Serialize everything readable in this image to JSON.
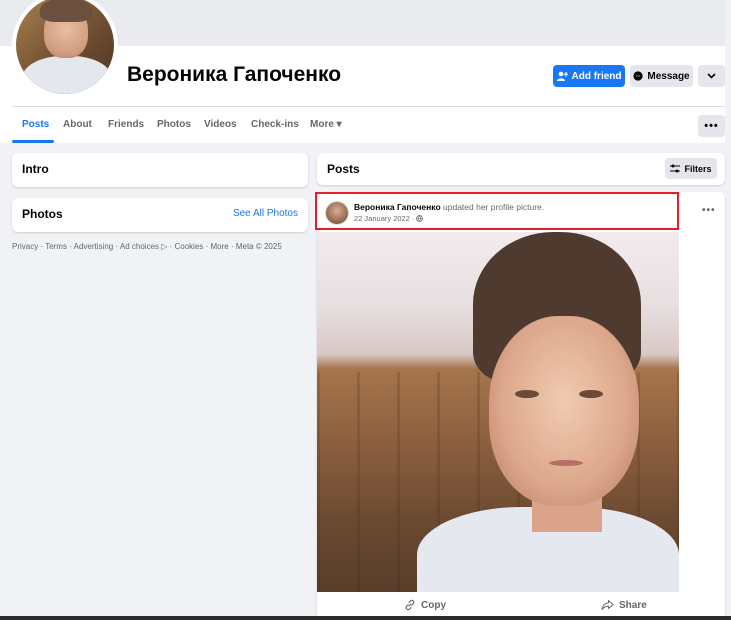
{
  "profile": {
    "name": "Вероника Гапоченко",
    "add_friend_label": "Add friend",
    "message_label": "Message"
  },
  "tabs": [
    {
      "label": "Posts",
      "active": true
    },
    {
      "label": "About"
    },
    {
      "label": "Friends"
    },
    {
      "label": "Photos"
    },
    {
      "label": "Videos"
    },
    {
      "label": "Check-ins"
    },
    {
      "label": "More ▾"
    }
  ],
  "intro": {
    "title": "Intro"
  },
  "photos": {
    "title": "Photos",
    "see_all_label": "See All Photos"
  },
  "footer": {
    "text": "Privacy · Terms · Advertising · Ad choices ▷ · Cookies · More · Meta © 2025"
  },
  "posts": {
    "title": "Posts",
    "filters_label": "Filters"
  },
  "post": {
    "author": "Вероника Гапоченко",
    "action": "updated her profile picture.",
    "date": "22 January 2022 ·",
    "copy_label": "Copy",
    "share_label": "Share"
  },
  "colors": {
    "accent": "#1877f2",
    "highlight": "#e41e26"
  },
  "icons": [
    "add-person-icon",
    "messenger-icon",
    "chevron-down-icon",
    "more-dots-icon",
    "filters-icon",
    "globe-icon",
    "link-icon",
    "share-icon"
  ]
}
